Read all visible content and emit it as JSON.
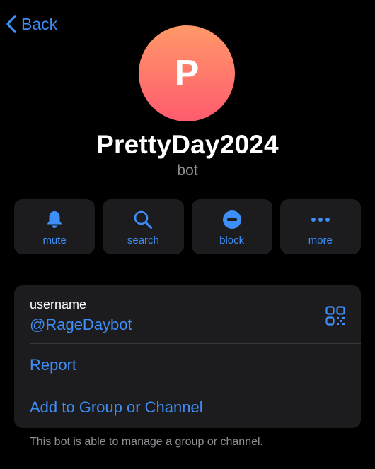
{
  "nav": {
    "back_label": "Back"
  },
  "profile": {
    "avatar_letter": "P",
    "name": "PrettyDay2024",
    "subtitle": "bot"
  },
  "actions": [
    {
      "icon": "bell-icon",
      "label": "mute"
    },
    {
      "icon": "search-icon",
      "label": "search"
    },
    {
      "icon": "block-icon",
      "label": "block"
    },
    {
      "icon": "more-icon",
      "label": "more"
    }
  ],
  "info": {
    "username_title": "username",
    "username_value": "@RageDaybot",
    "report_label": "Report",
    "add_label": "Add to Group or Channel"
  },
  "footnote": "This bot is able to manage a group or channel.",
  "colors": {
    "accent": "#3e8ef7",
    "background": "#000000",
    "card": "#1c1c1e",
    "secondary_text": "#8e8e93",
    "avatar_gradient_top": "#ff9968",
    "avatar_gradient_bottom": "#ff5b6e"
  }
}
